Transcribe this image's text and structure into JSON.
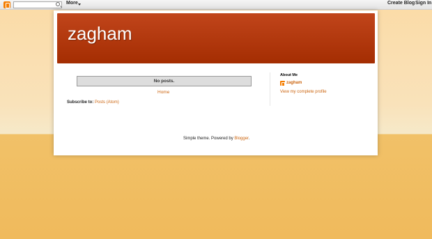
{
  "navbar": {
    "logo_icon": "blogger-icon",
    "search_placeholder": "",
    "more_label": "More",
    "create_blog_label": "Create Blog",
    "sign_in_label": "Sign In"
  },
  "header": {
    "title": "zagham"
  },
  "main": {
    "no_posts_label": "No posts.",
    "home_label": "Home",
    "subscribe_prefix": "Subscribe to:",
    "subscribe_link": "Posts (Atom)"
  },
  "sidebar": {
    "about_title": "About Me",
    "profile_name": "zagham",
    "profile_link": "View my complete profile"
  },
  "footer": {
    "text": "Simple theme. Powered by",
    "link": "Blogger",
    "suffix": "."
  },
  "colors": {
    "header": "#b13a0d",
    "link": "#cc6611",
    "background": "#f0ba5c"
  }
}
